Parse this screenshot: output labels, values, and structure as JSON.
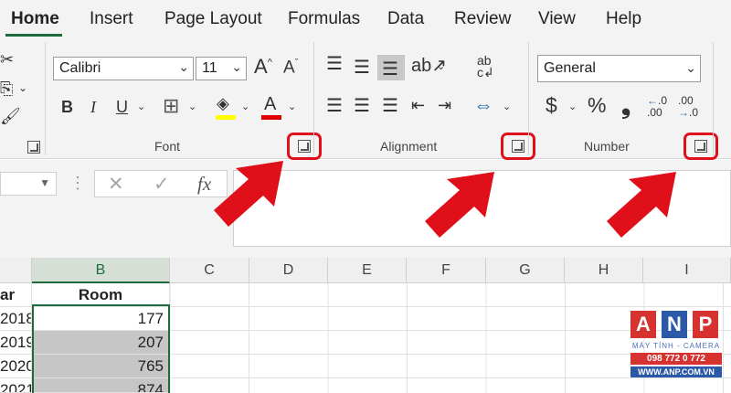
{
  "tabs": [
    {
      "label": "Home",
      "active": true
    },
    {
      "label": "Insert"
    },
    {
      "label": "Page Layout"
    },
    {
      "label": "Formulas"
    },
    {
      "label": "Data"
    },
    {
      "label": "Review"
    },
    {
      "label": "View"
    },
    {
      "label": "Help"
    }
  ],
  "font_group": {
    "label": "Font",
    "font_name": "Calibri",
    "font_size": "11",
    "grow_font": "A",
    "shrink_font": "A",
    "bold": "B",
    "italic": "I",
    "underline": "U",
    "font_color": "A",
    "fill_color": "#ffff00",
    "font_color_value": "#e00000"
  },
  "alignment_group": {
    "label": "Alignment",
    "wrap_text": "ab c"
  },
  "number_group": {
    "label": "Number",
    "format": "General",
    "currency": "$",
    "percent": "%",
    "comma": "❟",
    "increase_decimal": ".0\n.00",
    "decrease_decimal": ".00\n.0"
  },
  "formula_bar": {
    "fx": "fx",
    "cancel": "✕",
    "enter": "✓",
    "dots": "⋮"
  },
  "columns": [
    "B",
    "C",
    "D",
    "E",
    "F",
    "G",
    "H",
    "I"
  ],
  "column_a_partial": "",
  "rows": [
    {
      "a": "ar",
      "b": "Room"
    },
    {
      "a": "2018",
      "b": "177"
    },
    {
      "a": "2019",
      "b": "207"
    },
    {
      "a": "2020",
      "b": "765"
    },
    {
      "a": "2021",
      "b": "874"
    }
  ],
  "watermark": {
    "letters": [
      "A",
      "N",
      "P"
    ],
    "tagline": "MÁY TÍNH - CAMERA",
    "phone": "098 772 0 772",
    "website": "WWW.ANP.COM.VN",
    "colors": [
      "#d6322f",
      "#2c58a8",
      "#d6322f"
    ]
  },
  "accent": "#1e6c3e",
  "highlight": "#e0101b"
}
